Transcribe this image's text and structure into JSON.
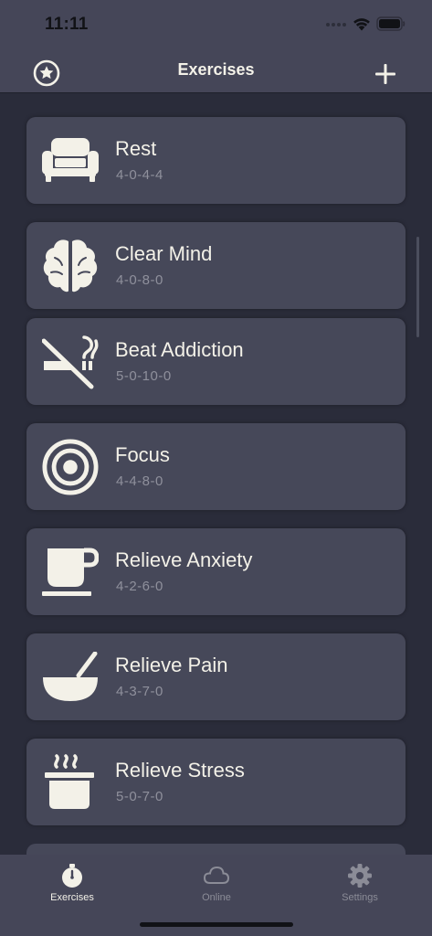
{
  "status_bar": {
    "time": "11:11"
  },
  "header": {
    "title": "Exercises"
  },
  "exercises": [
    {
      "name": "Rest",
      "pattern": "4-0-4-4",
      "icon": "couch-icon"
    },
    {
      "name": "Clear Mind",
      "pattern": "4-0-8-0",
      "icon": "brain-icon"
    },
    {
      "name": "Beat Addiction",
      "pattern": "5-0-10-0",
      "icon": "no-smoking-icon"
    },
    {
      "name": "Focus",
      "pattern": "4-4-8-0",
      "icon": "target-icon"
    },
    {
      "name": "Relieve Anxiety",
      "pattern": "4-2-6-0",
      "icon": "coffee-cup-icon"
    },
    {
      "name": "Relieve Pain",
      "pattern": "4-3-7-0",
      "icon": "mortar-pestle-icon"
    },
    {
      "name": "Relieve Stress",
      "pattern": "5-0-7-0",
      "icon": "steaming-pot-icon"
    }
  ],
  "tabs": [
    {
      "label": "Exercises",
      "icon": "stopwatch-icon",
      "active": true
    },
    {
      "label": "Online",
      "icon": "cloud-icon",
      "active": false
    },
    {
      "label": "Settings",
      "icon": "gear-icon",
      "active": false
    }
  ],
  "colors": {
    "background": "#2a2c3a",
    "card": "#464859",
    "bar": "#454658",
    "text": "#f3f1e8",
    "muted": "#8f909c"
  }
}
